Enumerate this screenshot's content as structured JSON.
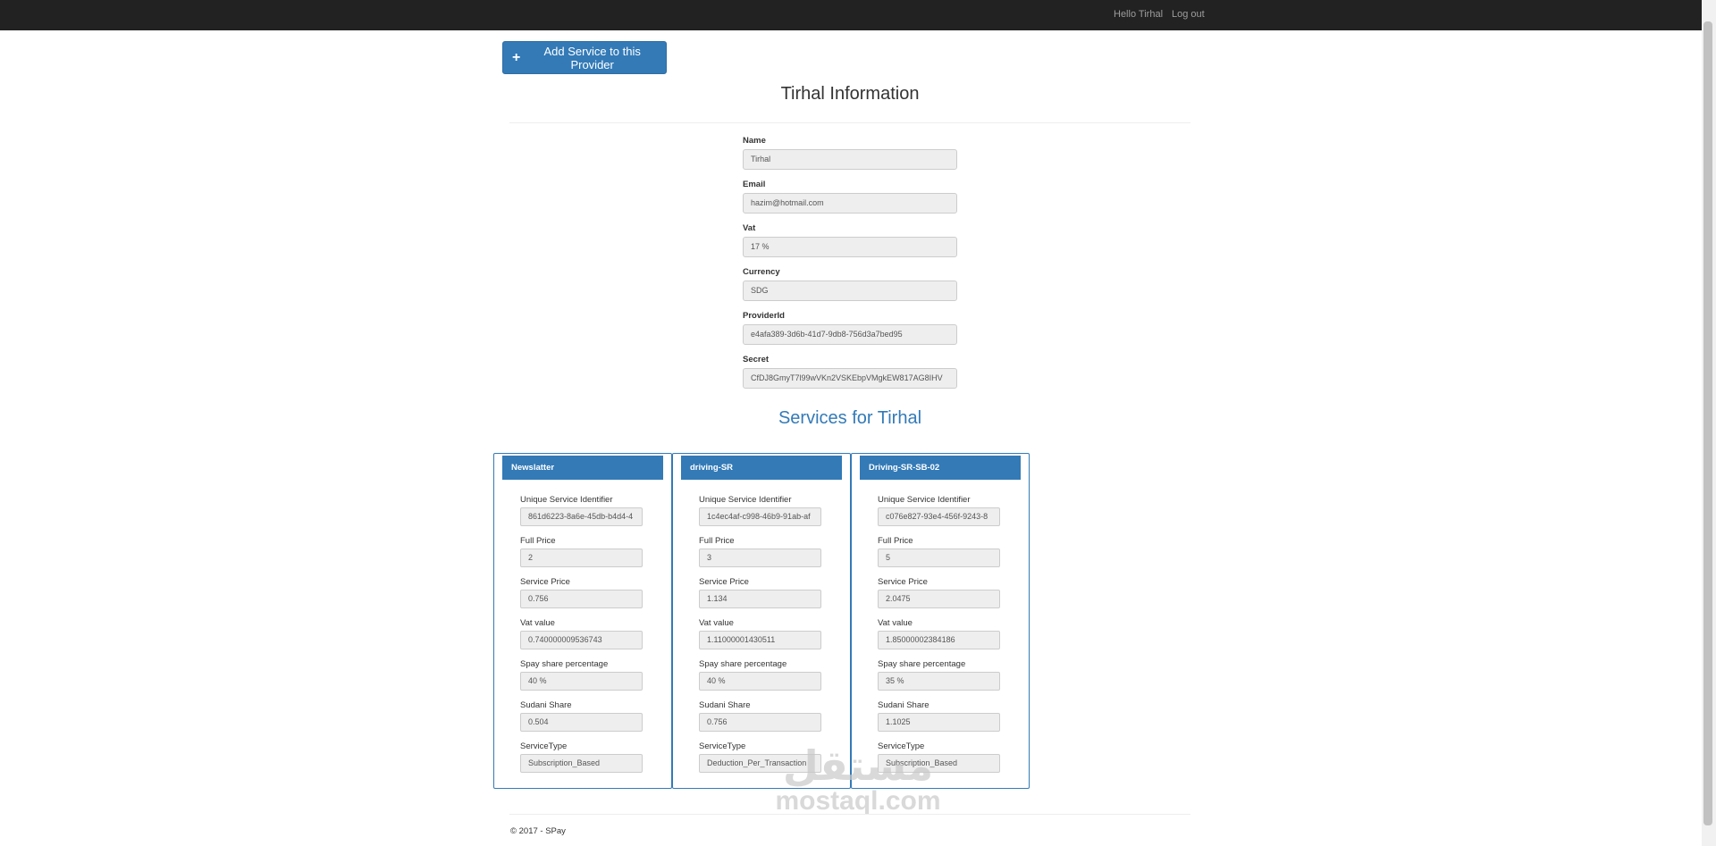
{
  "navbar": {
    "hello": "Hello Tirhal",
    "logout": "Log out"
  },
  "actions": {
    "add_service_label": "Add Service to this Provider",
    "add_service_icon": "plus-icon"
  },
  "page_title": "Tirhal Information",
  "provider_fields": [
    {
      "label": "Name",
      "value": "Tirhal"
    },
    {
      "label": "Email",
      "value": "hazim@hotmail.com"
    },
    {
      "label": "Vat",
      "value": "17 %"
    },
    {
      "label": "Currency",
      "value": "SDG"
    },
    {
      "label": "ProviderId",
      "value": "e4afa389-3d6b-41d7-9db8-756d3a7bed95"
    },
    {
      "label": "Secret",
      "value": "CfDJ8GmyT7l99wVKn2VSKEbpVMgkEW817AG8IHV"
    }
  ],
  "services_title": "Services for Tirhal",
  "services": [
    {
      "name": "Newslatter",
      "fields": [
        {
          "label": "Unique Service Identifier",
          "value": "861d6223-8a6e-45db-b4d4-4"
        },
        {
          "label": "Full Price",
          "value": "2"
        },
        {
          "label": "Service Price",
          "value": "0.756"
        },
        {
          "label": "Vat value",
          "value": "0.740000009536743"
        },
        {
          "label": "Spay share percentage",
          "value": "40  %"
        },
        {
          "label": "Sudani Share",
          "value": "0.504"
        },
        {
          "label": "ServiceType",
          "value": "Subscription_Based"
        }
      ]
    },
    {
      "name": "driving-SR",
      "fields": [
        {
          "label": "Unique Service Identifier",
          "value": "1c4ec4af-c998-46b9-91ab-af"
        },
        {
          "label": "Full Price",
          "value": "3"
        },
        {
          "label": "Service Price",
          "value": "1.134"
        },
        {
          "label": "Vat value",
          "value": "1.11000001430511"
        },
        {
          "label": "Spay share percentage",
          "value": "40  %"
        },
        {
          "label": "Sudani Share",
          "value": "0.756"
        },
        {
          "label": "ServiceType",
          "value": "Deduction_Per_Transaction"
        }
      ]
    },
    {
      "name": "Driving-SR-SB-02",
      "fields": [
        {
          "label": "Unique Service Identifier",
          "value": "c076e827-93e4-456f-9243-8"
        },
        {
          "label": "Full Price",
          "value": "5"
        },
        {
          "label": "Service Price",
          "value": "2.0475"
        },
        {
          "label": "Vat value",
          "value": "1.85000002384186"
        },
        {
          "label": "Spay share percentage",
          "value": "35  %"
        },
        {
          "label": "Sudani Share",
          "value": "1.1025"
        },
        {
          "label": "ServiceType",
          "value": "Subscription_Based"
        }
      ]
    }
  ],
  "footer": "© 2017 - SPay",
  "watermark": {
    "arabic": "مستقل",
    "latin": "mostaql.com"
  },
  "colors": {
    "navbar": "#222222",
    "primary": "#337ab7",
    "input_bg": "#eeeeee"
  }
}
